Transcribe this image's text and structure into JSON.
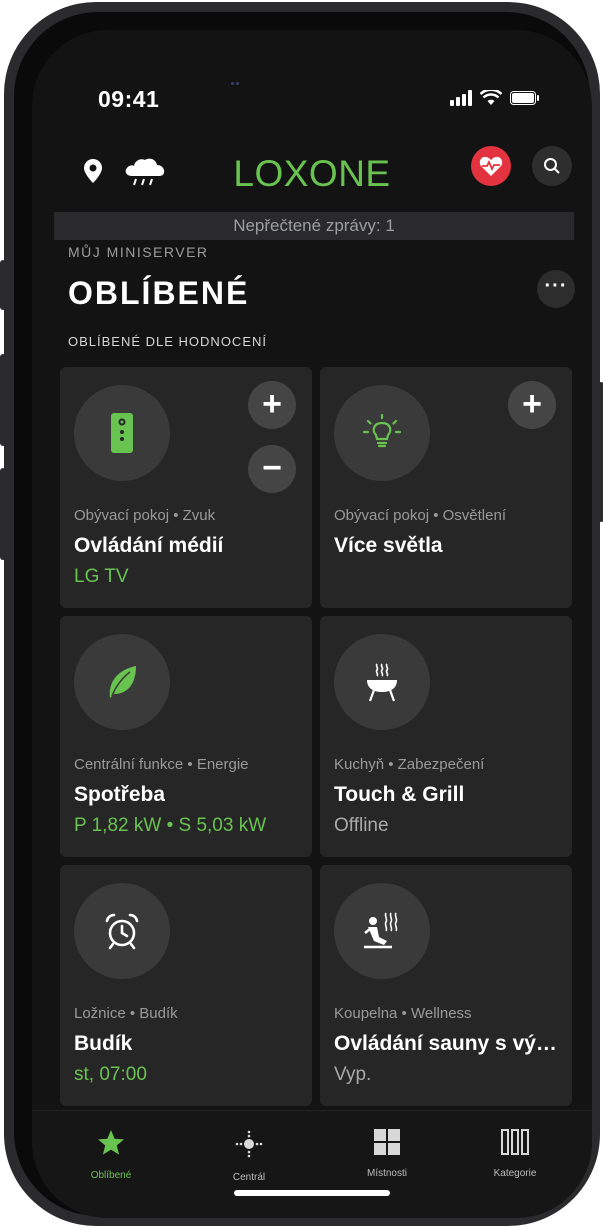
{
  "status_bar": {
    "time": "09:41"
  },
  "header": {
    "brand": "LOXONE"
  },
  "messages_bar": {
    "text": "Nepřečtené zprávy: 1"
  },
  "section": {
    "subtitle": "MŮJ MINISERVER",
    "title": "OBLÍBENÉ",
    "more_label": "···"
  },
  "group_title": "OBLÍBENÉ DLE HODNOCENÍ",
  "tiles": [
    {
      "subtitle": "Obývací pokoj • Zvuk",
      "name": "Ovládání médií",
      "status": "LG TV",
      "icon": "remote-control-icon"
    },
    {
      "subtitle": "Obývací pokoj • Osvětlení",
      "name": "Více světla",
      "status": "",
      "icon": "light-bulb-icon"
    },
    {
      "subtitle": "Centrální funkce • Energie",
      "name": "Spotřeba",
      "status": "P 1,82 kW • S 5,03 kW",
      "icon": "leaf-icon"
    },
    {
      "subtitle": "Kuchyň • Zabezpečení",
      "name": "Touch & Grill",
      "status": "Offline",
      "icon": "grill-icon"
    },
    {
      "subtitle": "Ložnice • Budík",
      "name": "Budík",
      "status": "st, 07:00",
      "icon": "alarm-clock-icon"
    },
    {
      "subtitle": "Koupelna • Wellness",
      "name": "Ovládání sauny s vý…",
      "status": "Vyp.",
      "icon": "sauna-icon"
    }
  ],
  "buttons": {
    "plus": "+",
    "minus": "−"
  },
  "tabs": [
    {
      "label": "Oblíbené",
      "icon": "star-icon",
      "active": true
    },
    {
      "label": "Centrál",
      "icon": "central-icon",
      "active": false
    },
    {
      "label": "Místnosti",
      "icon": "rooms-icon",
      "active": false
    },
    {
      "label": "Kategorie",
      "icon": "categories-icon",
      "active": false
    }
  ],
  "colors": {
    "accent": "#69c350",
    "health": "#e2333f",
    "background": "#131313",
    "tile": "#262626"
  }
}
